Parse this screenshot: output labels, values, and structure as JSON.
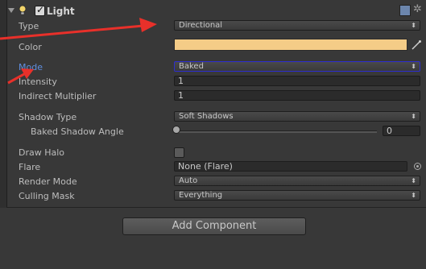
{
  "component": {
    "title": "Light",
    "enabled": true
  },
  "fields": {
    "type": {
      "label": "Type",
      "value": "Directional"
    },
    "color": {
      "label": "Color",
      "value": "#f4cc87"
    },
    "mode": {
      "label": "Mode",
      "value": "Baked"
    },
    "intensity": {
      "label": "Intensity",
      "value": "1"
    },
    "indirect_multiplier": {
      "label": "Indirect Multiplier",
      "value": "1"
    },
    "shadow_type": {
      "label": "Shadow Type",
      "value": "Soft Shadows"
    },
    "baked_shadow_angle": {
      "label": "Baked Shadow Angle",
      "value": "0"
    },
    "draw_halo": {
      "label": "Draw Halo",
      "checked": false
    },
    "flare": {
      "label": "Flare",
      "value": "None (Flare)"
    },
    "render_mode": {
      "label": "Render Mode",
      "value": "Auto"
    },
    "culling_mask": {
      "label": "Culling Mask",
      "value": "Everything"
    }
  },
  "add_component": {
    "label": "Add Component"
  },
  "icons": {
    "fold": "triangle-down-icon",
    "light": "light-bulb-icon",
    "help": "help-book-icon",
    "settings": "gear-icon",
    "dropdown": "chevron-down-icon",
    "eyedropper": "eyedropper-icon",
    "object_picker": "object-picker-icon"
  },
  "annotation_color": "#e8302a",
  "accent_color": "#5f8fe0"
}
